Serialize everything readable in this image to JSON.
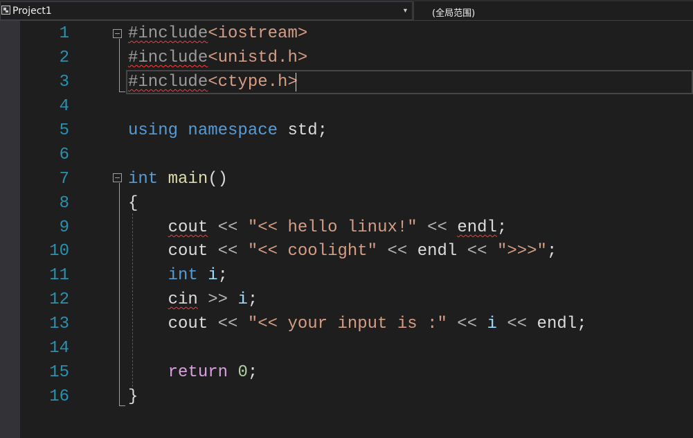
{
  "navbar": {
    "project_label": "Project1",
    "project_icon": "project-icon",
    "dropdown_icon": "chevron-down-icon",
    "scope_label": "(全局范围)"
  },
  "editor": {
    "line_numbers": [
      "1",
      "2",
      "3",
      "4",
      "5",
      "6",
      "7",
      "8",
      "9",
      "10",
      "11",
      "12",
      "13",
      "14",
      "15",
      "16"
    ],
    "lines": {
      "l1": {
        "pp": "#include",
        "inc": "<iostream>"
      },
      "l2": {
        "pp": "#include",
        "inc": "<unistd.h>"
      },
      "l3": {
        "pp": "#include",
        "inc": "<ctype.h>"
      },
      "l5": {
        "kw1": "using",
        "kw2": "namespace",
        "id": "std",
        "semi": ";"
      },
      "l7": {
        "kw": "int",
        "fn": "main",
        "paren": "()"
      },
      "l8": {
        "brace": "{"
      },
      "l9": {
        "obj": "cout",
        "op1": "<<",
        "str": "\"<< hello linux!\"",
        "op2": "<<",
        "endl": "endl",
        "semi": ";"
      },
      "l10": {
        "obj": "cout",
        "op1": "<<",
        "str1": "\"<< coolight\"",
        "op2": "<<",
        "endl": "endl",
        "op3": "<<",
        "str2": "\">>>\"",
        "semi": ";"
      },
      "l11": {
        "kw": "int",
        "var": "i",
        "semi": ";"
      },
      "l12": {
        "obj": "cin",
        "op": ">>",
        "var": "i",
        "semi": ";"
      },
      "l13": {
        "obj": "cout",
        "op1": "<<",
        "str": "\"<< your input is :\"",
        "op2": "<<",
        "var": "i",
        "op3": "<<",
        "endl": "endl",
        "semi": ";"
      },
      "l15": {
        "kw": "return",
        "num": "0",
        "semi": ";"
      },
      "l16": {
        "brace": "}"
      }
    }
  },
  "colors": {
    "background": "#1e1e1e",
    "keyword": "#569cd6",
    "string": "#d69d85",
    "line_number": "#2b91af",
    "error_squiggle": "#ff3b3b"
  }
}
